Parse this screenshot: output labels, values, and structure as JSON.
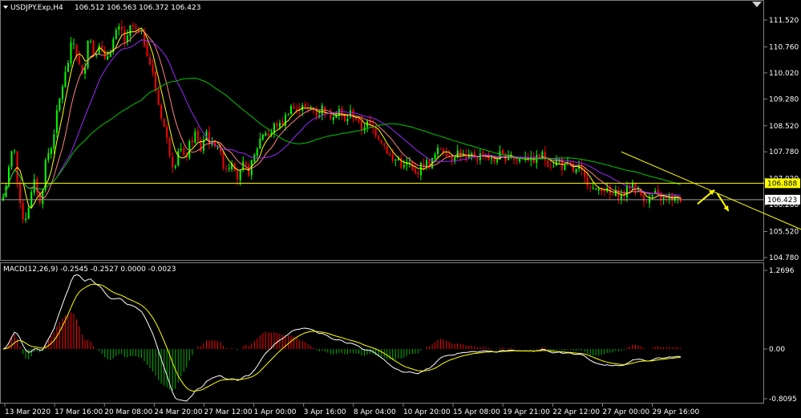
{
  "header": {
    "symbol": "USDJPY.Exp,H4",
    "ohlc": "106.512 106.563 106.372 106.423"
  },
  "macd": {
    "label": "MACD(12,26,9) -0.2545 -0.2527 0.0000 -0.0023"
  },
  "colors": {
    "background": "#000000",
    "axis": "#808080",
    "bull_candle": "#00ff00",
    "bear_candle": "#ff0000",
    "ma_fast": "#ffff00",
    "ma_mid": "#ff8080",
    "ma_slow": "#9c27ff",
    "ma_long": "#00c800",
    "level_line": "#ffff00",
    "trend_line": "#ffff00",
    "hist_pos": "#ff0000",
    "hist_neg": "#00b000",
    "macd_line": "#ffffff",
    "signal_line": "#ffff00"
  },
  "chart_data": [
    {
      "type": "candlestick",
      "title": "USDJPY.Exp,H4",
      "ylim": [
        104.78,
        111.5
      ],
      "y_ticks": [
        "111.520",
        "110.760",
        "110.020",
        "109.280",
        "108.520",
        "107.780",
        "107.020",
        "106.280",
        "105.520",
        "104.780"
      ],
      "x_ticks": [
        "13 Mar 2020",
        "17 Mar 16:00",
        "20 Mar 08:00",
        "24 Mar 20:00",
        "27 Mar 12:00",
        "1 Apr 00:00",
        "3 Apr 16:00",
        "8 Apr 04:00",
        "10 Apr 20:00",
        "15 Apr 08:00",
        "19 Apr 21:00",
        "22 Apr 12:00",
        "27 Apr 00:00",
        "29 Apr 16:00"
      ],
      "close_series": {
        "x": [
          0,
          2,
          4,
          6,
          8,
          10,
          12,
          14,
          16,
          18,
          20,
          22,
          24,
          26,
          28,
          30,
          32,
          34,
          36,
          38,
          40,
          42,
          44,
          46,
          48,
          50,
          52,
          54,
          56,
          58,
          60,
          62,
          64,
          66,
          68,
          70,
          72,
          74,
          76,
          78,
          80,
          82,
          84,
          86,
          88,
          90,
          92,
          94,
          96,
          98,
          100,
          102,
          104,
          106,
          108,
          110,
          112,
          114,
          116,
          118,
          120,
          122,
          124,
          126,
          128,
          130,
          132,
          134,
          136,
          138,
          140,
          142,
          144,
          146,
          148,
          150,
          152,
          154,
          156,
          158,
          160,
          162,
          164,
          166,
          168,
          170,
          172,
          174,
          176,
          178,
          180,
          182,
          184,
          186,
          188,
          190,
          192,
          194,
          196,
          198,
          200,
          202,
          204,
          206,
          208,
          210,
          212,
          214,
          216,
          218,
          220,
          222,
          224,
          226,
          228,
          230,
          232,
          234,
          236,
          238,
          240,
          242,
          244,
          246,
          248,
          250,
          252,
          254
        ],
        "close": [
          106.5,
          107.2,
          108.1,
          106.3,
          105.8,
          106.4,
          107.0,
          106.2,
          107.6,
          107.9,
          108.8,
          109.6,
          110.2,
          111.0,
          110.4,
          109.8,
          111.2,
          110.5,
          110.9,
          110.3,
          110.7,
          111.1,
          111.3,
          110.8,
          111.4,
          111.2,
          111.1,
          110.6,
          110.0,
          109.2,
          108.6,
          107.9,
          107.3,
          108.0,
          107.5,
          108.0,
          108.3,
          107.8,
          108.4,
          107.9,
          108.1,
          107.5,
          107.3,
          107.6,
          107.0,
          107.4,
          107.2,
          107.6,
          108.1,
          108.4,
          108.2,
          108.6,
          108.5,
          108.8,
          109.1,
          108.9,
          109.2,
          108.9,
          109.0,
          108.8,
          109.1,
          108.7,
          108.9,
          109.0,
          108.6,
          108.9,
          108.8,
          108.4,
          108.6,
          108.5,
          108.3,
          108.1,
          107.8,
          107.5,
          107.6,
          107.3,
          107.5,
          107.1,
          107.3,
          107.5,
          107.4,
          107.7,
          107.9,
          107.8,
          107.6,
          107.8,
          107.7,
          107.5,
          107.7,
          107.6,
          107.8,
          107.6,
          107.5,
          107.7,
          107.6,
          107.8,
          107.5,
          107.6,
          107.7,
          107.5,
          107.6,
          107.7,
          107.5,
          107.4,
          107.6,
          107.3,
          107.4,
          107.2,
          107.3,
          107.0,
          106.9,
          106.6,
          106.8,
          106.7,
          106.5,
          106.6,
          106.5,
          106.7,
          106.9,
          106.6,
          106.5,
          106.4,
          106.6,
          106.5,
          106.4,
          106.5,
          106.4,
          106.42
        ]
      },
      "horizontal_levels": [
        106.888,
        106.423
      ],
      "trend_line": {
        "from": [
          219,
          107.78
        ],
        "to": [
          285,
          105.5
        ]
      },
      "arrows": [
        {
          "from": [
            246,
            106.3
          ],
          "to": [
            252,
            106.7
          ]
        },
        {
          "from": [
            253,
            106.6
          ],
          "to": [
            257,
            106.1
          ]
        }
      ],
      "price_tags": [
        {
          "value": 106.888,
          "label": "106.888"
        },
        {
          "value": 106.423,
          "label": "106.423"
        }
      ]
    },
    {
      "type": "bar",
      "title": "MACD(12,26,9) -0.2545 -0.2527 0.0000 -0.0023",
      "ylim": [
        -0.8095,
        1.2696
      ],
      "y_ticks": [
        "1.2696",
        "0.00",
        "-0.8095"
      ]
    }
  ]
}
